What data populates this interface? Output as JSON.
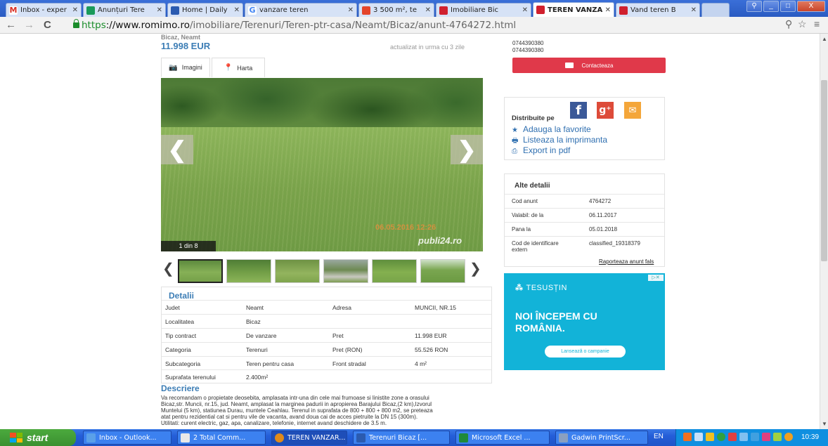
{
  "browser": {
    "tabs": [
      {
        "label": "Inbox - exper",
        "color": "#d93025"
      },
      {
        "label": "Anunțuri Tere",
        "color": "#1a9a5a"
      },
      {
        "label": "Home | Daily",
        "color": "#2b5bb0"
      },
      {
        "label": "vanzare teren",
        "color": "#4285f4"
      },
      {
        "label": "3 500 m², te",
        "color": "#e4442a"
      },
      {
        "label": "Imobiliare Bic",
        "color": "#d0202e"
      },
      {
        "label": "TEREN VANZA",
        "color": "#d0202e",
        "active": true
      },
      {
        "label": "Vand teren B",
        "color": "#d0202e"
      }
    ],
    "url_scheme": "https",
    "url_host": "://www.romimo.ro",
    "url_path": "/imobiliare/Terenuri/Teren-ptr-casa/Neamt/Bicaz/anunt-4764272.html",
    "nav": {
      "back": "←",
      "forward": "→",
      "reload": "C"
    },
    "window_controls": {
      "minimize": "_",
      "maximize": "□",
      "close": "X"
    }
  },
  "listing": {
    "location": "Bicaz, Neamt",
    "price": "11.998 EUR",
    "updated": "actualizat in urma cu 3 zile",
    "tabs": {
      "images": "Imagini",
      "map": "Harta"
    },
    "photo": {
      "date_stamp": "06.05.2016 12:26",
      "watermark": "publi24.ro",
      "counter": "1 din 8"
    },
    "details": {
      "title": "Detalii",
      "rows": [
        {
          "k1": "Judet",
          "v1": "Neamt",
          "k2": "Adresa",
          "v2": "MUNCII, NR.15"
        },
        {
          "k1": "Localitatea",
          "v1": "Bicaz",
          "k2": "",
          "v2": ""
        },
        {
          "k1": "Tip contract",
          "v1": "De vanzare",
          "k2": "Pret",
          "v2": "11.998 EUR"
        },
        {
          "k1": "Categoria",
          "v1": "Terenuri",
          "k2": "Pret (RON)",
          "v2": "55.526 RON"
        },
        {
          "k1": "Subcategoria",
          "v1": "Teren pentru casa",
          "k2": "Front stradal",
          "v2": "4 m²"
        },
        {
          "k1": "Suprafata terenului",
          "v1": "2.400m²",
          "k2": "",
          "v2": ""
        }
      ]
    },
    "description": {
      "title": "Descriere",
      "lines": [
        "Va recomandam o propietate deosebita, amplasata intr-una din cele mai frumoase si linistite zone a orasului",
        "Bicaz,str. Muncii, nr.15, jud. Neamt, amplasat la marginea padurii in apropierea Barajului Bicaz,(2 km),Izvorul",
        "Muntelui (5 km), statiunea Durau, muntele Ceahlau. Terenul in suprafata de 800 + 800 + 800 m2, se preteaza",
        "atat pentru rezidential cat si pentru vile de vacanta, avand doua cai de acces pietruite la DN 15 (300m).",
        "Utilitati: curent electric, gaz, apa, canalizare, telefonie, internet avand deschidere de 3.5 m."
      ]
    }
  },
  "sidebar": {
    "phones": [
      "0744390380",
      "0744390380"
    ],
    "contact_label": "Contacteaza",
    "share": {
      "label": "Distribuite pe",
      "links": [
        {
          "icon": "star-icon",
          "glyph": "★",
          "label": "Adauga la favorite"
        },
        {
          "icon": "printer-icon",
          "glyph": "🖶",
          "label": "Listeaza la imprimanta"
        },
        {
          "icon": "pdf-icon",
          "glyph": "⎙",
          "label": "Export in pdf"
        }
      ]
    },
    "other_details": {
      "title": "Alte detalii",
      "rows": [
        {
          "k": "Cod anunt",
          "v": "4764272"
        },
        {
          "k": "Valabil: de la",
          "v": "06.11.2017"
        },
        {
          "k": "Pana la",
          "v": "05.01.2018"
        },
        {
          "k": "Cod de identificare extern",
          "v": "classified_19318379"
        }
      ],
      "report": "Raporteaza anunt fals"
    },
    "ad": {
      "logo": "TESUSȚIN",
      "headline_1": "NOI ÎNCEPEM CU",
      "headline_2": "ROMÂNIA.",
      "button": "Lansează o campanie"
    }
  },
  "taskbar": {
    "start": "start",
    "items": [
      {
        "label": "Inbox - Outlook...",
        "color": "#5aa0e8"
      },
      {
        "label": "2 Total Comm...",
        "color": "#e8e8e8"
      },
      {
        "label": "TEREN VANZAR...",
        "color": "#e08a1a",
        "active": true
      },
      {
        "label": "Terenuri Bicaz [...",
        "color": "#2b5bb0"
      },
      {
        "label": "Microsoft Excel ...",
        "color": "#1f8a3a"
      },
      {
        "label": "Gadwin PrintScr...",
        "color": "#8aa0c0"
      }
    ],
    "lang": "EN",
    "clock": "10:39"
  }
}
